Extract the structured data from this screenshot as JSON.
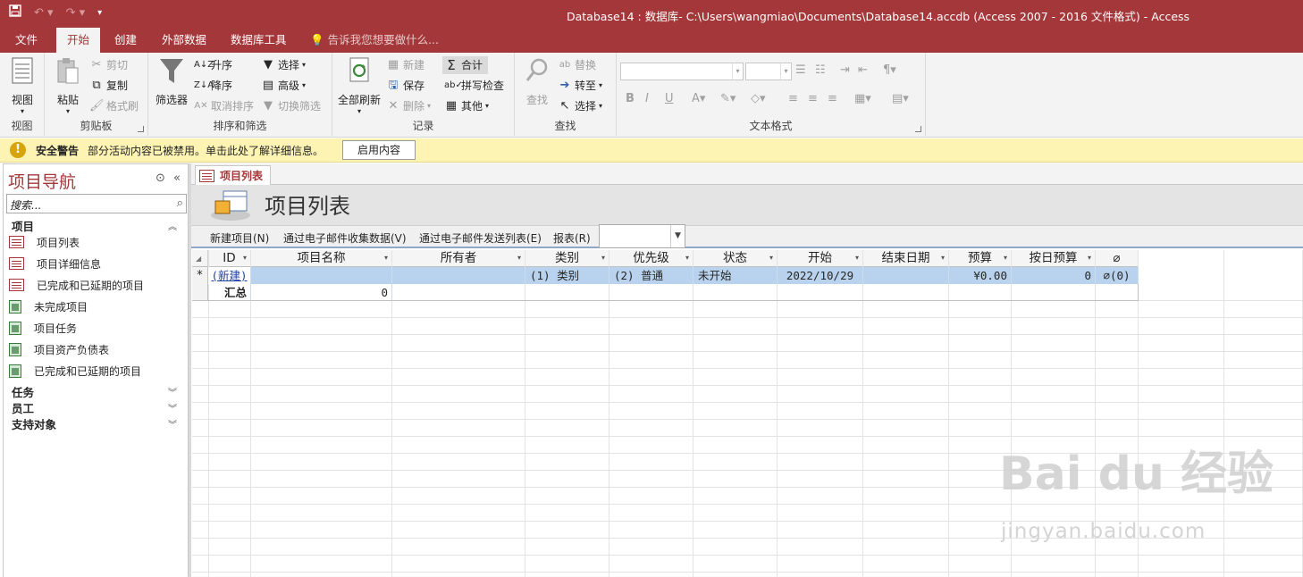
{
  "titlebar": {
    "title": "Database14 : 数据库- C:\\Users\\wangmiao\\Documents\\Database14.accdb (Access 2007 - 2016 文件格式) - Access",
    "save_icon": "save-icon",
    "undo_icon": "undo-icon",
    "redo_icon": "redo-icon",
    "customize_icon": "customize-qat-icon"
  },
  "tabs": {
    "file": "文件",
    "home": "开始",
    "create": "创建",
    "external": "外部数据",
    "dbtools": "数据库工具",
    "tell": "告诉我您想要做什么..."
  },
  "ribbon": {
    "views": {
      "view": "视图",
      "label": "视图"
    },
    "clipboard": {
      "paste": "粘贴",
      "cut": "剪切",
      "copy": "复制",
      "format_painter": "格式刷",
      "label": "剪贴板"
    },
    "sort": {
      "filter": "筛选器",
      "asc": "升序",
      "desc": "降序",
      "remove_sort": "取消排序",
      "selection": "选择",
      "advanced": "高级",
      "toggle_filter": "切换筛选",
      "label": "排序和筛选"
    },
    "records": {
      "refresh": "全部刷新",
      "new": "新建",
      "save": "保存",
      "delete": "删除",
      "totals": "合计",
      "spelling": "拼写检查",
      "more": "其他",
      "label": "记录"
    },
    "find": {
      "find": "查找",
      "replace": "替换",
      "goto": "转至",
      "select": "选择",
      "label": "查找"
    },
    "text": {
      "label": "文本格式"
    }
  },
  "security": {
    "title": "安全警告",
    "message": "部分活动内容已被禁用。单击此处了解详细信息。",
    "button": "启用内容"
  },
  "nav": {
    "title": "项目导航",
    "search_placeholder": "搜索...",
    "sections": {
      "projects": "项目",
      "tasks": "任务",
      "employees": "员工",
      "support": "支持对象"
    },
    "items": [
      {
        "label": "项目列表",
        "type": "form"
      },
      {
        "label": "项目详细信息",
        "type": "form"
      },
      {
        "label": "已完成和已延期的项目",
        "type": "form"
      },
      {
        "label": "未完成项目",
        "type": "report"
      },
      {
        "label": "项目任务",
        "type": "report"
      },
      {
        "label": "项目资产负债表",
        "type": "report"
      },
      {
        "label": "已完成和已延期的项目",
        "type": "report"
      }
    ]
  },
  "doc": {
    "tab": "项目列表",
    "title": "项目列表",
    "commands": {
      "new_project": "新建项目(N)",
      "collect_email": "通过电子邮件收集数据(V)",
      "send_list": "通过电子邮件发送列表(E)",
      "reports": "报表(R)"
    }
  },
  "grid": {
    "columns": [
      "ID",
      "项目名称",
      "所有者",
      "类别",
      "优先级",
      "状态",
      "开始",
      "结束日期",
      "预算",
      "按日预算",
      "📎"
    ],
    "new_row": {
      "marker": "*",
      "id": "(新建)",
      "category": "(1) 类别",
      "priority": "(2) 普通",
      "status": "未开始",
      "start": "2022/10/29",
      "budget": "¥0.00",
      "daily_budget": "0",
      "attachments": "(0)"
    },
    "totals_row": {
      "label": "汇总",
      "project_name_total": "0"
    }
  },
  "watermark": {
    "main": "Bai du 经验",
    "sub": "jingyan.baidu.com"
  }
}
